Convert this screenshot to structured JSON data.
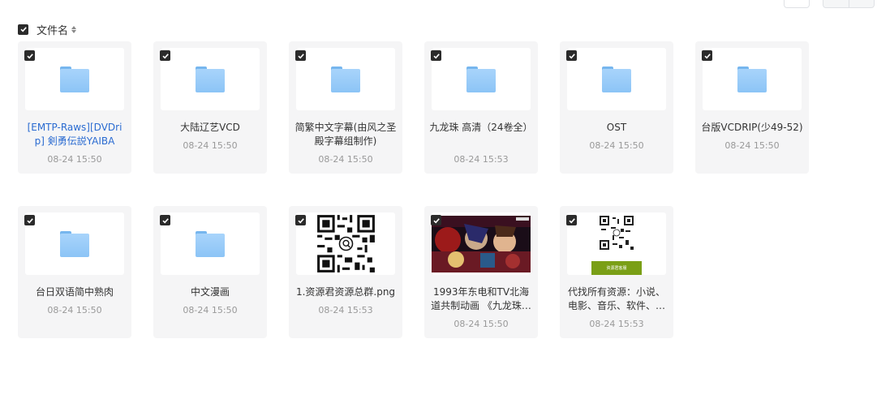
{
  "toolbar": {
    "select_all_checked": true,
    "sort_label": "文件名"
  },
  "colors": {
    "checkbox": "#2b2b2b",
    "card_bg": "#f5f5f6",
    "folder": "#8cc4f6",
    "link": "#2a6bd1",
    "date": "#999999",
    "ad_bar": "#7a9f16"
  },
  "files": [
    {
      "name": "[EMTP-Raws][DVDrip] 剣勇伝説YAIBA",
      "date": "08-24 15:50",
      "type": "folder",
      "checked": true,
      "icon": "folder-icon"
    },
    {
      "name": "大陆辽艺VCD",
      "date": "08-24 15:50",
      "type": "folder",
      "checked": true,
      "icon": "folder-icon"
    },
    {
      "name": "简繁中文字幕(由风之圣殿字幕组制作)",
      "date": "08-24 15:50",
      "type": "folder",
      "checked": true,
      "icon": "folder-icon"
    },
    {
      "name": "九龙珠 高清（24卷全）",
      "date": "08-24 15:53",
      "type": "folder",
      "checked": true,
      "icon": "folder-icon"
    },
    {
      "name": "OST",
      "date": "08-24 15:50",
      "type": "folder",
      "checked": true,
      "icon": "folder-icon"
    },
    {
      "name": "台版VCDRIP(少49-52)",
      "date": "08-24 15:50",
      "type": "folder",
      "checked": true,
      "icon": "folder-icon"
    },
    {
      "name": "台日双语简中熟肉",
      "date": "08-24 15:50",
      "type": "folder",
      "checked": true,
      "icon": "folder-icon"
    },
    {
      "name": "中文漫画",
      "date": "08-24 15:50",
      "type": "folder",
      "checked": true,
      "icon": "folder-icon"
    },
    {
      "name": "1.资源君资源总群.png",
      "date": "08-24 15:53",
      "type": "image",
      "checked": true,
      "icon": "qr-code-thumbnail"
    },
    {
      "name": "1993年东电和TV北海道共制动画 《九龙珠…",
      "date": "08-24 15:50",
      "type": "image",
      "checked": true,
      "icon": "anime-poster-thumbnail"
    },
    {
      "name": "代找所有资源：小说、电影、音乐、软件、…",
      "date": "08-24 15:53",
      "type": "image",
      "checked": true,
      "icon": "ad-qr-thumbnail"
    }
  ],
  "ad_bar_text": "资源君客服"
}
